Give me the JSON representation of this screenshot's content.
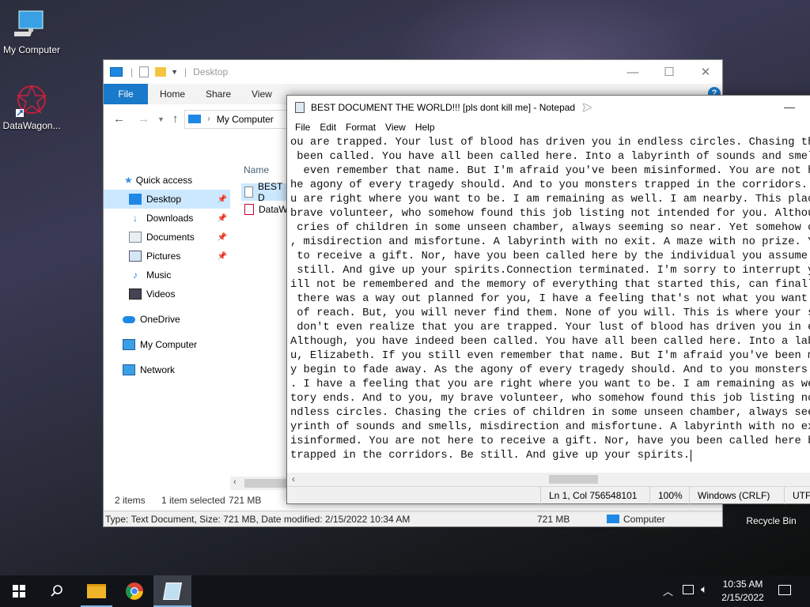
{
  "desktop": {
    "icons": [
      {
        "label": "My Computer"
      },
      {
        "label": "DataWagon..."
      },
      {
        "label": "Recycle Bin"
      }
    ]
  },
  "explorer": {
    "title": "Desktop",
    "ribbon_tabs": [
      "File",
      "Home",
      "Share",
      "View"
    ],
    "address": "My Computer",
    "nav": [
      {
        "label": "Quick access",
        "pinned": false
      },
      {
        "label": "Desktop",
        "pinned": true
      },
      {
        "label": "Downloads",
        "pinned": true
      },
      {
        "label": "Documents",
        "pinned": true
      },
      {
        "label": "Pictures",
        "pinned": true
      },
      {
        "label": "Music",
        "pinned": false
      },
      {
        "label": "Videos",
        "pinned": false
      },
      {
        "label": "OneDrive",
        "pinned": false
      },
      {
        "label": "My Computer",
        "pinned": false
      },
      {
        "label": "Network",
        "pinned": false
      }
    ],
    "column_header": "Name",
    "files": [
      "BEST D",
      "DataW"
    ],
    "status": {
      "items": "2 items",
      "selected": "1 item selected",
      "size": "721 MB"
    },
    "detail": {
      "text": "Type: Text Document, Size: 721 MB, Date modified: 2/15/2022 10:34 AM",
      "size": "721 MB",
      "location": "Computer"
    }
  },
  "notepad": {
    "title": "BEST DOCUMENT THE WORLD!!! [pls dont kill me] - Notepad",
    "menu": [
      "File",
      "Edit",
      "Format",
      "View",
      "Help"
    ],
    "lines": [
      "ou are trapped. Your lust of blood has driven you in endless circles. Chasing the",
      " been called. You have all been called here. Into a labyrinth of sounds and smells,",
      "  even remember that name. But I'm afraid you've been misinformed. You are not here",
      "he agony of every tragedy should. And to you monsters trapped in the corridors. Be",
      "u are right where you want to be. I am remaining as well. I am nearby. This place w",
      "brave volunteer, who somehow found this job listing not intended for you. Although",
      " cries of children in some unseen chamber, always seeming so near. Yet somehow out",
      ", misdirection and misfortune. A labyrinth with no exit. A maze with no prize. You",
      " to receive a gift. Nor, have you been called here by the individual you assume. A",
      " still. And give up your spirits.Connection terminated. I'm sorry to interrupt you",
      "ill not be remembered and the memory of everything that started this, can finally",
      " there was a way out planned for you, I have a feeling that's not what you want. I",
      " of reach. But, you will never find them. None of you will. This is where your sto",
      " don't even realize that you are trapped. Your lust of blood has driven you in end",
      "Although, you have indeed been called. You have all been called here. Into a labyr",
      "u, Elizabeth. If you still even remember that name. But I'm afraid you've been mis",
      "y begin to fade away. As the agony of every tragedy should. And to you monsters tr",
      ". I have a feeling that you are right where you want to be. I am remaining as well",
      "tory ends. And to you, my brave volunteer, who somehow found this job listing not",
      "ndless circles. Chasing the cries of children in some unseen chamber, always seemi",
      "yrinth of sounds and smells, misdirection and misfortune. A labyrinth with no exit",
      "isinformed. You are not here to receive a gift. Nor, have you been called here by t",
      "trapped in the corridors. Be still. And give up your spirits."
    ],
    "status": {
      "position": "Ln 1, Col 756548101",
      "zoom": "100%",
      "eol": "Windows (CRLF)",
      "encoding": "UTF-"
    }
  },
  "taskbar": {
    "clock_time": "10:35 AM",
    "clock_date": "2/15/2022"
  },
  "colors": {
    "accent": "#1979ca",
    "taskbar": "#101418",
    "selection": "#cce8ff"
  }
}
